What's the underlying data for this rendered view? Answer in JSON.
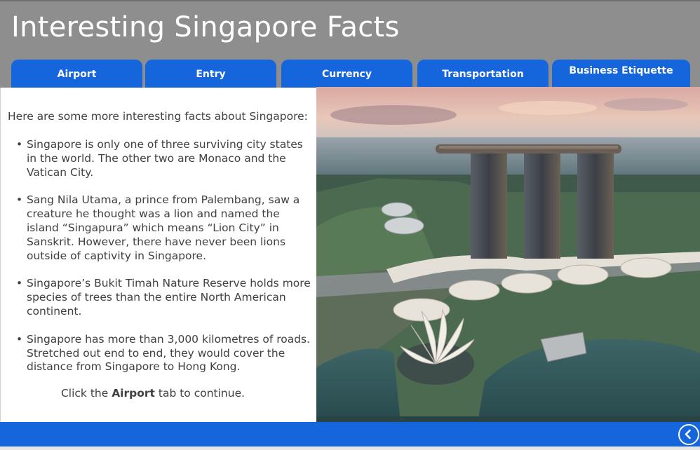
{
  "header": {
    "title": "Interesting Singapore Facts"
  },
  "tabs": [
    {
      "label": "Airport"
    },
    {
      "label": "Entry"
    },
    {
      "label": "Currency"
    },
    {
      "label": "Transportation"
    },
    {
      "label": "Business Etiquette"
    }
  ],
  "content": {
    "intro": "Here are some more interesting facts about Singapore:",
    "bullet_glyph": "•",
    "facts": [
      "Singapore is only one of three surviving city states in the world. The other two are Monaco and the Vatican City.",
      "Sang Nila Utama, a prince from Palembang, saw a creature he thought was a lion and named the island “Singapura” which means “Lion City” in Sanskrit. However, there have never been lions outside of captivity in Singapore.",
      "Singapore’s Bukit Timah Nature Reserve holds more species of trees than the entire North American continent.",
      "Singapore has more than 3,000 kilometres of roads. Stretched out end to end, they would cover the distance from Singapore to Hong Kong."
    ],
    "cta_prefix": "Click the ",
    "cta_tab": "Airport",
    "cta_suffix": " tab to continue."
  },
  "footer": {
    "nav_icon": "back-arrow-icon"
  },
  "colors": {
    "accent": "#1565dd",
    "header": "#8e8e8e",
    "text": "#404040"
  }
}
